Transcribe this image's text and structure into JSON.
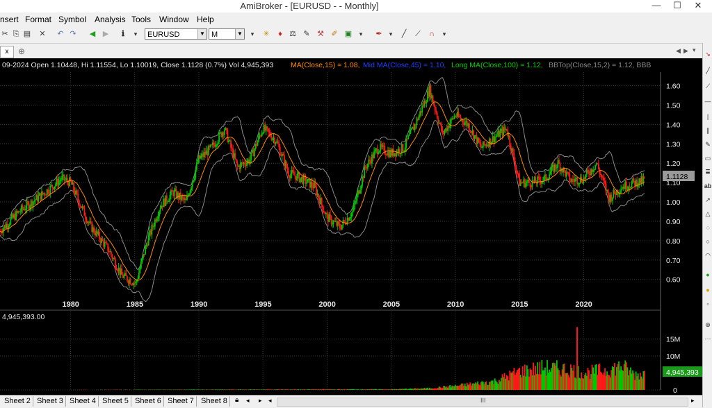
{
  "window": {
    "title": "AmiBroker - [EURUSD -  - Monthly]",
    "close_glyph": "✕",
    "min_glyph": "—",
    "max_glyph": "☐"
  },
  "menu": [
    "nsert",
    "Format",
    "Symbol",
    "Analysis",
    "Tools",
    "Window",
    "Help"
  ],
  "toolbar": {
    "symbol": "EURUSD",
    "interval": "M"
  },
  "doc_tab": {
    "close_glyph": "x",
    "add_glyph": "⊕"
  },
  "chart": {
    "info_line": {
      "date_ohlc": "09-2024 Open 1.10448, Hi 1.11554, Lo 1.10019, Close 1.1128 (0.7%) Vol 4,945,393",
      "ma": "MA(Close,15) = 1.08,",
      "mid_ma": "Mid MA(Close,45) = 1.10,",
      "long_ma": "Long MA(Close,100) = 1.12,",
      "bb": "BBTop(Close,15,2) = 1.12, BBB"
    },
    "last_price": "1.1128",
    "volume_label": "4,945,393.00",
    "last_volume": "4,945,393",
    "colors": {
      "up": "#00c800",
      "down": "#ff1a1a",
      "ma": "#ff8c00",
      "bb": "#8a8a8a",
      "grid": "#3a3a3a",
      "label_blue": "#1e40ff",
      "label_green": "#00d000"
    }
  },
  "chart_data": {
    "type": "candlestick",
    "x_ticks": [
      "1980",
      "1985",
      "1990",
      "1995",
      "2000",
      "2005",
      "2010",
      "2015",
      "2020"
    ],
    "y_ticks": [
      "1.60",
      "1.50",
      "1.40",
      "1.30",
      "1.20",
      "1.10",
      "1.00",
      "0.90",
      "0.80",
      "0.70",
      "0.60"
    ],
    "ylim": [
      0.47,
      1.67
    ],
    "xlim": [
      1974.5,
      2026.0
    ],
    "volume_ticks": [
      "15M",
      "10M",
      "0"
    ],
    "volume_ylim": [
      0,
      20
    ],
    "price_path": [
      [
        1974.5,
        0.85
      ],
      [
        1976,
        0.95
      ],
      [
        1978,
        1.05
      ],
      [
        1979.3,
        1.12
      ],
      [
        1980,
        1.1
      ],
      [
        1981.5,
        0.88
      ],
      [
        1983,
        0.75
      ],
      [
        1984,
        0.62
      ],
      [
        1985.1,
        0.58
      ],
      [
        1986,
        0.8
      ],
      [
        1987,
        0.98
      ],
      [
        1988,
        1.05
      ],
      [
        1989,
        1.0
      ],
      [
        1990,
        1.22
      ],
      [
        1991,
        1.28
      ],
      [
        1992,
        1.38
      ],
      [
        1993,
        1.18
      ],
      [
        1994,
        1.22
      ],
      [
        1995,
        1.38
      ],
      [
        1996,
        1.32
      ],
      [
        1997,
        1.15
      ],
      [
        1998,
        1.12
      ],
      [
        1999,
        1.08
      ],
      [
        2000,
        0.92
      ],
      [
        2001,
        0.87
      ],
      [
        2002,
        0.95
      ],
      [
        2003,
        1.18
      ],
      [
        2004,
        1.28
      ],
      [
        2005,
        1.25
      ],
      [
        2006,
        1.28
      ],
      [
        2007,
        1.42
      ],
      [
        2008,
        1.58
      ],
      [
        2009,
        1.35
      ],
      [
        2010,
        1.45
      ],
      [
        2011,
        1.4
      ],
      [
        2012,
        1.28
      ],
      [
        2013,
        1.33
      ],
      [
        2014,
        1.38
      ],
      [
        2015,
        1.1
      ],
      [
        2016,
        1.1
      ],
      [
        2017,
        1.12
      ],
      [
        2018,
        1.2
      ],
      [
        2019,
        1.11
      ],
      [
        2020,
        1.12
      ],
      [
        2021,
        1.2
      ],
      [
        2022,
        1.02
      ],
      [
        2023,
        1.08
      ],
      [
        2024,
        1.1
      ],
      [
        2024.75,
        1.1128
      ]
    ],
    "volume_points": [
      [
        1974.5,
        0
      ],
      [
        2005,
        0.2
      ],
      [
        2008,
        0.5
      ],
      [
        2010,
        1.2
      ],
      [
        2013,
        2.5
      ],
      [
        2015,
        5.5
      ],
      [
        2017,
        6.5
      ],
      [
        2019,
        6.0
      ],
      [
        2020,
        5.0
      ],
      [
        2022,
        6.0
      ],
      [
        2023,
        7.0
      ],
      [
        2024,
        4.5
      ],
      [
        2024.75,
        4.9
      ]
    ],
    "volume_spike": {
      "x": 2019.5,
      "value": 18.5
    }
  },
  "sheets": [
    "Sheet 2",
    "Sheet 3",
    "Sheet 4",
    "Sheet 5",
    "Sheet 6",
    "Sheet 7",
    "Sheet 8"
  ],
  "scroll_glyph": "III"
}
